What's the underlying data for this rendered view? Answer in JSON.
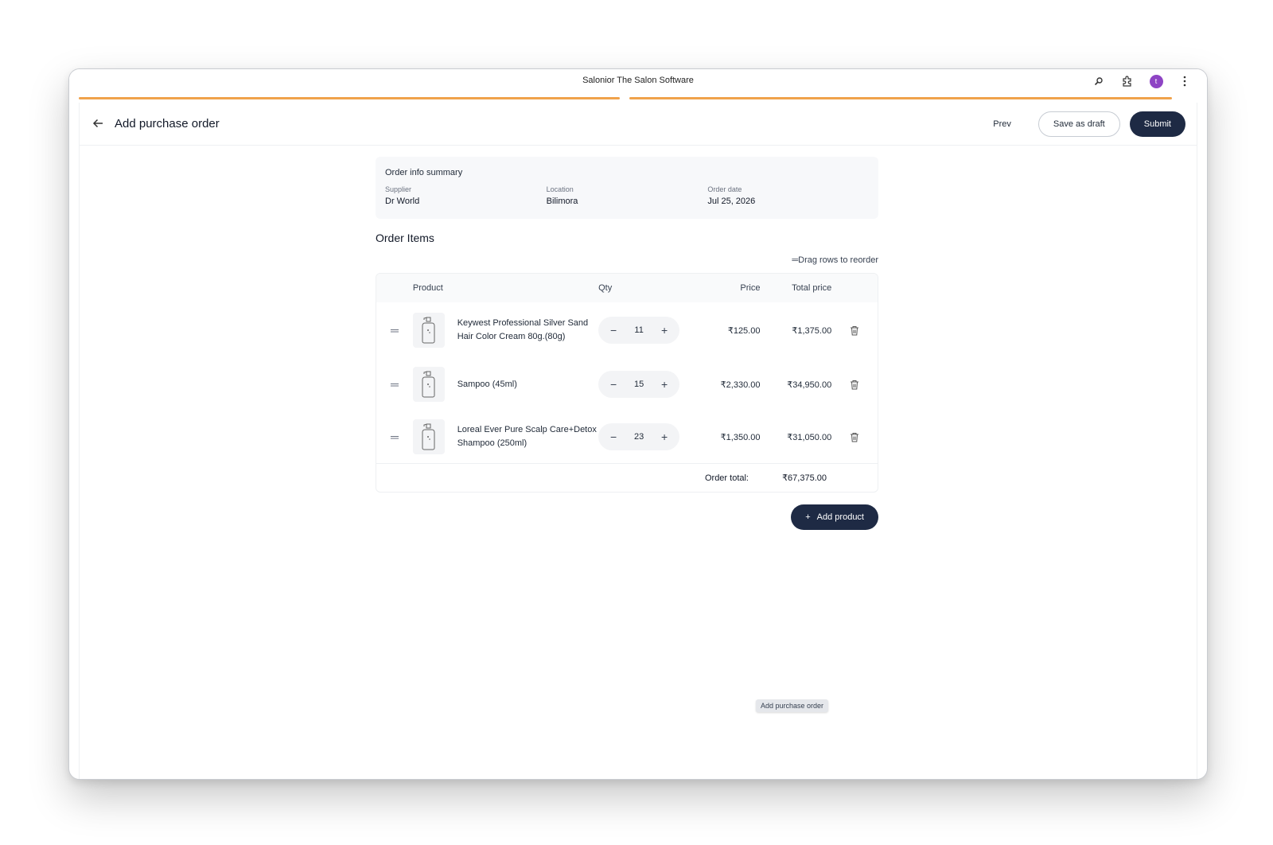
{
  "window": {
    "title": "Salonior The Salon Software",
    "avatar_letter": "t",
    "icons": [
      "zoom-icon",
      "extension-icon",
      "avatar",
      "more-vertical-icon"
    ]
  },
  "progress_color": "#f0a24b",
  "header": {
    "title": "Add purchase order",
    "prev_label": "Prev",
    "draft_label": "Save as draft",
    "submit_label": "Submit"
  },
  "summary": {
    "title": "Order info summary",
    "supplier_label": "Supplier",
    "supplier_value": "Dr World",
    "location_label": "Location",
    "location_value": "Bilimora",
    "date_label": "Order date",
    "date_value": "Jul 25, 2026"
  },
  "items": {
    "title": "Order Items",
    "drag_hint": "Drag rows to reorder",
    "columns": {
      "product": "Product",
      "qty": "Qty",
      "price": "Price",
      "total": "Total price"
    },
    "rows": [
      {
        "product": "Keywest Professional Silver Sand Hair Color Cream 80g.(80g)",
        "qty": "11",
        "price": "₹125.00",
        "total": "₹1,375.00"
      },
      {
        "product": "Sampoo (45ml)",
        "qty": "15",
        "price": "₹2,330.00",
        "total": "₹34,950.00"
      },
      {
        "product": "Loreal Ever Pure Scalp Care+Detox Shampoo (250ml)",
        "qty": "23",
        "price": "₹1,350.00",
        "total": "₹31,050.00"
      }
    ],
    "order_total_label": "Order total:",
    "order_total_value": "₹67,375.00"
  },
  "add_product_label": "Add product",
  "tooltip": "Add purchase order",
  "accent_dark": "#1e2a44"
}
